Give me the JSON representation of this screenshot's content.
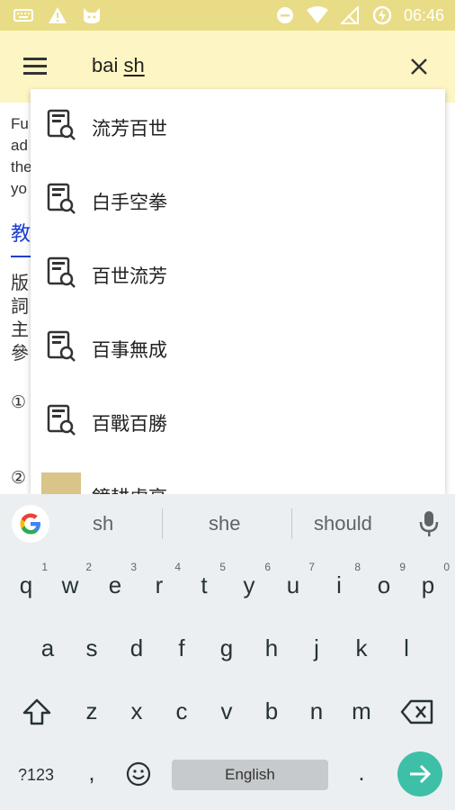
{
  "status_bar": {
    "time": "06:46",
    "colors": {
      "background": "#e9dc86",
      "icons": "#ffffff"
    },
    "icons": [
      "keyboard-icon",
      "warning-icon",
      "cat-icon",
      "do-not-disturb-icon",
      "wifi-icon",
      "signal-icon",
      "battery-saver-icon"
    ]
  },
  "toolbar": {
    "query_prefix": "bai ",
    "query_composing": "sh",
    "colors": {
      "background": "#fdf6c4"
    }
  },
  "background_page": {
    "text_lines": [
      "Fu",
      "ad",
      "the",
      "yo"
    ],
    "link": "教",
    "cjk_lines": [
      "版",
      "詞",
      "主",
      "參"
    ],
    "circled": [
      "①",
      "②"
    ]
  },
  "suggestions": [
    {
      "label": "流芳百世",
      "icon": "dictionary-search-icon"
    },
    {
      "label": "白手空拳",
      "icon": "dictionary-search-icon"
    },
    {
      "label": "百世流芳",
      "icon": "dictionary-search-icon"
    },
    {
      "label": "百事無成",
      "icon": "dictionary-search-icon"
    },
    {
      "label": "百戰百勝",
      "icon": "dictionary-search-icon"
    },
    {
      "label": "鏡耕虛亭",
      "icon": "image-thumbnail"
    }
  ],
  "keyboard": {
    "suggestion_strip": [
      "sh",
      "she",
      "should"
    ],
    "row1": [
      {
        "key": "q",
        "hint": "1"
      },
      {
        "key": "w",
        "hint": "2"
      },
      {
        "key": "e",
        "hint": "3"
      },
      {
        "key": "r",
        "hint": "4"
      },
      {
        "key": "t",
        "hint": "5"
      },
      {
        "key": "y",
        "hint": "6"
      },
      {
        "key": "u",
        "hint": "7"
      },
      {
        "key": "i",
        "hint": "8"
      },
      {
        "key": "o",
        "hint": "9"
      },
      {
        "key": "p",
        "hint": "0"
      }
    ],
    "row2": [
      "a",
      "s",
      "d",
      "f",
      "g",
      "h",
      "j",
      "k",
      "l"
    ],
    "row3": [
      "z",
      "x",
      "c",
      "v",
      "b",
      "n",
      "m"
    ],
    "symbols_key": "?123",
    "comma_key": ",",
    "space_label": "English",
    "period_key": ".",
    "colors": {
      "background": "#eceff1",
      "enter": "#3ec0a8"
    }
  }
}
